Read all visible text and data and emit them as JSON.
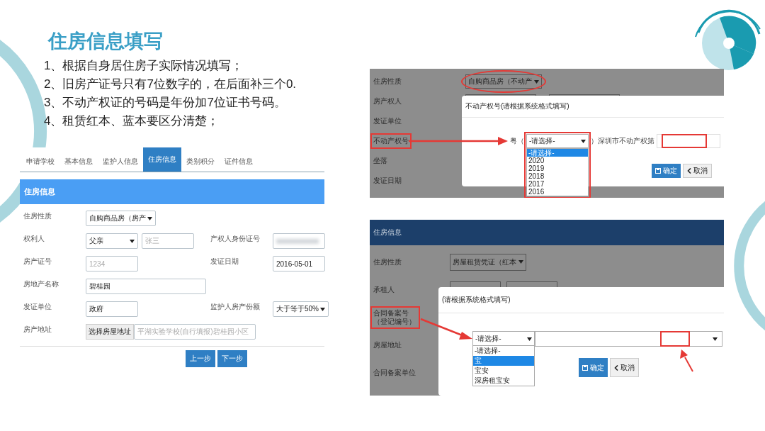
{
  "title": "住房信息填写",
  "notes": [
    "1、根据自身居住房子实际情况填写；",
    "2、旧房产证号只有7位数字的，在后面补三个0.",
    "3、不动产权证的号码是年份加7位证书号码。",
    "4、租赁红本、蓝本要区分清楚；"
  ],
  "form_screenshot": {
    "tabs": [
      {
        "label": "申请学校",
        "selected": false
      },
      {
        "label": "基本信息",
        "selected": false
      },
      {
        "label": "监护人信息",
        "selected": false
      },
      {
        "label": "住房信息",
        "selected": true
      },
      {
        "label": "类别积分",
        "selected": false
      },
      {
        "label": "证件信息",
        "selected": false
      }
    ],
    "section_title": "住房信息",
    "rows": [
      {
        "label": "住房性质",
        "controls": [
          {
            "kind": "select",
            "value": "自购商品房（房产"
          }
        ]
      },
      {
        "label": "权利人",
        "controls": [
          {
            "kind": "select",
            "value": "父亲"
          },
          {
            "kind": "input",
            "placeholder": "张三"
          }
        ],
        "label_2": "产权人身份证号",
        "controls_2": [
          {
            "kind": "blurred"
          }
        ]
      },
      {
        "label": "房产证号",
        "controls": [
          {
            "kind": "input",
            "placeholder": "1234"
          }
        ],
        "label_2": "发证日期",
        "controls_2": [
          {
            "kind": "input",
            "value": "2016-05-01"
          }
        ]
      },
      {
        "label": "房地产名称",
        "controls": [
          {
            "kind": "wide_input",
            "value": "碧桂园"
          }
        ]
      },
      {
        "label": "发证单位",
        "controls": [
          {
            "kind": "input",
            "value": "政府"
          }
        ],
        "label_2": "监护人房产份额",
        "controls_2": [
          {
            "kind": "select",
            "value": "大于等于50%"
          }
        ]
      },
      {
        "label": "房产地址",
        "controls": [
          {
            "kind": "addon_button",
            "value": "选择房屋地址"
          },
          {
            "kind": "addon_input",
            "placeholder": "平湖实验学校(自行填报)碧桂园小区"
          }
        ]
      }
    ],
    "buttons": [
      "上一步",
      "下一步"
    ]
  },
  "property_screenshot": {
    "labels": [
      {
        "text": "住房性质",
        "highlighted": false
      },
      {
        "text": "房产权人",
        "highlighted": false
      },
      {
        "text": "发证单位",
        "highlighted": false
      },
      {
        "text": "不动产权号",
        "highlighted": true
      },
      {
        "text": "坐落",
        "highlighted": false
      },
      {
        "text": "发证日期",
        "highlighted": false
      }
    ],
    "type_select": {
      "value": "自购商品房（不动产",
      "circled": true
    },
    "dialog": {
      "title": "不动产权号(请根据系统格式填写)",
      "prefix": "粤（",
      "select": "-请选择-",
      "select_highlighted": true,
      "middle": "）深圳市不动产权第",
      "input_highlighted": true,
      "options": [
        {
          "label": "-请选择-",
          "selected": true
        },
        {
          "label": "2020",
          "selected": false
        },
        {
          "label": "2019",
          "selected": false
        },
        {
          "label": "2018",
          "selected": false
        },
        {
          "label": "2017",
          "selected": false
        },
        {
          "label": "2016",
          "selected": false
        }
      ],
      "buttons": [
        {
          "label": "确定",
          "kind": "primary"
        },
        {
          "label": "取消",
          "kind": "back"
        }
      ]
    }
  },
  "lease_screenshot": {
    "header": "住房信息",
    "labels": [
      {
        "text": "住房性质",
        "highlighted": false
      },
      {
        "text": "承租人",
        "highlighted": false
      },
      {
        "text": "合同备案号（登记编号）",
        "highlighted": true
      },
      {
        "text": "房屋地址",
        "highlighted": false
      },
      {
        "text": "合同备案单位",
        "highlighted": false
      }
    ],
    "type_select": {
      "value": "房屋租赁凭证（红本",
      "circled": false
    },
    "dialog": {
      "title": "(请根据系统格式填写)",
      "select": "-请选择-",
      "input_highlighted": true,
      "options": [
        {
          "label": "-请选择-",
          "selected": false
        },
        {
          "label": "宝",
          "selected": true
        },
        {
          "label": "宝安",
          "selected": false
        },
        {
          "label": "深房租宝安",
          "selected": false
        }
      ],
      "buttons": [
        {
          "label": "确定",
          "kind": "primary"
        },
        {
          "label": "取消",
          "kind": "back"
        }
      ]
    }
  }
}
